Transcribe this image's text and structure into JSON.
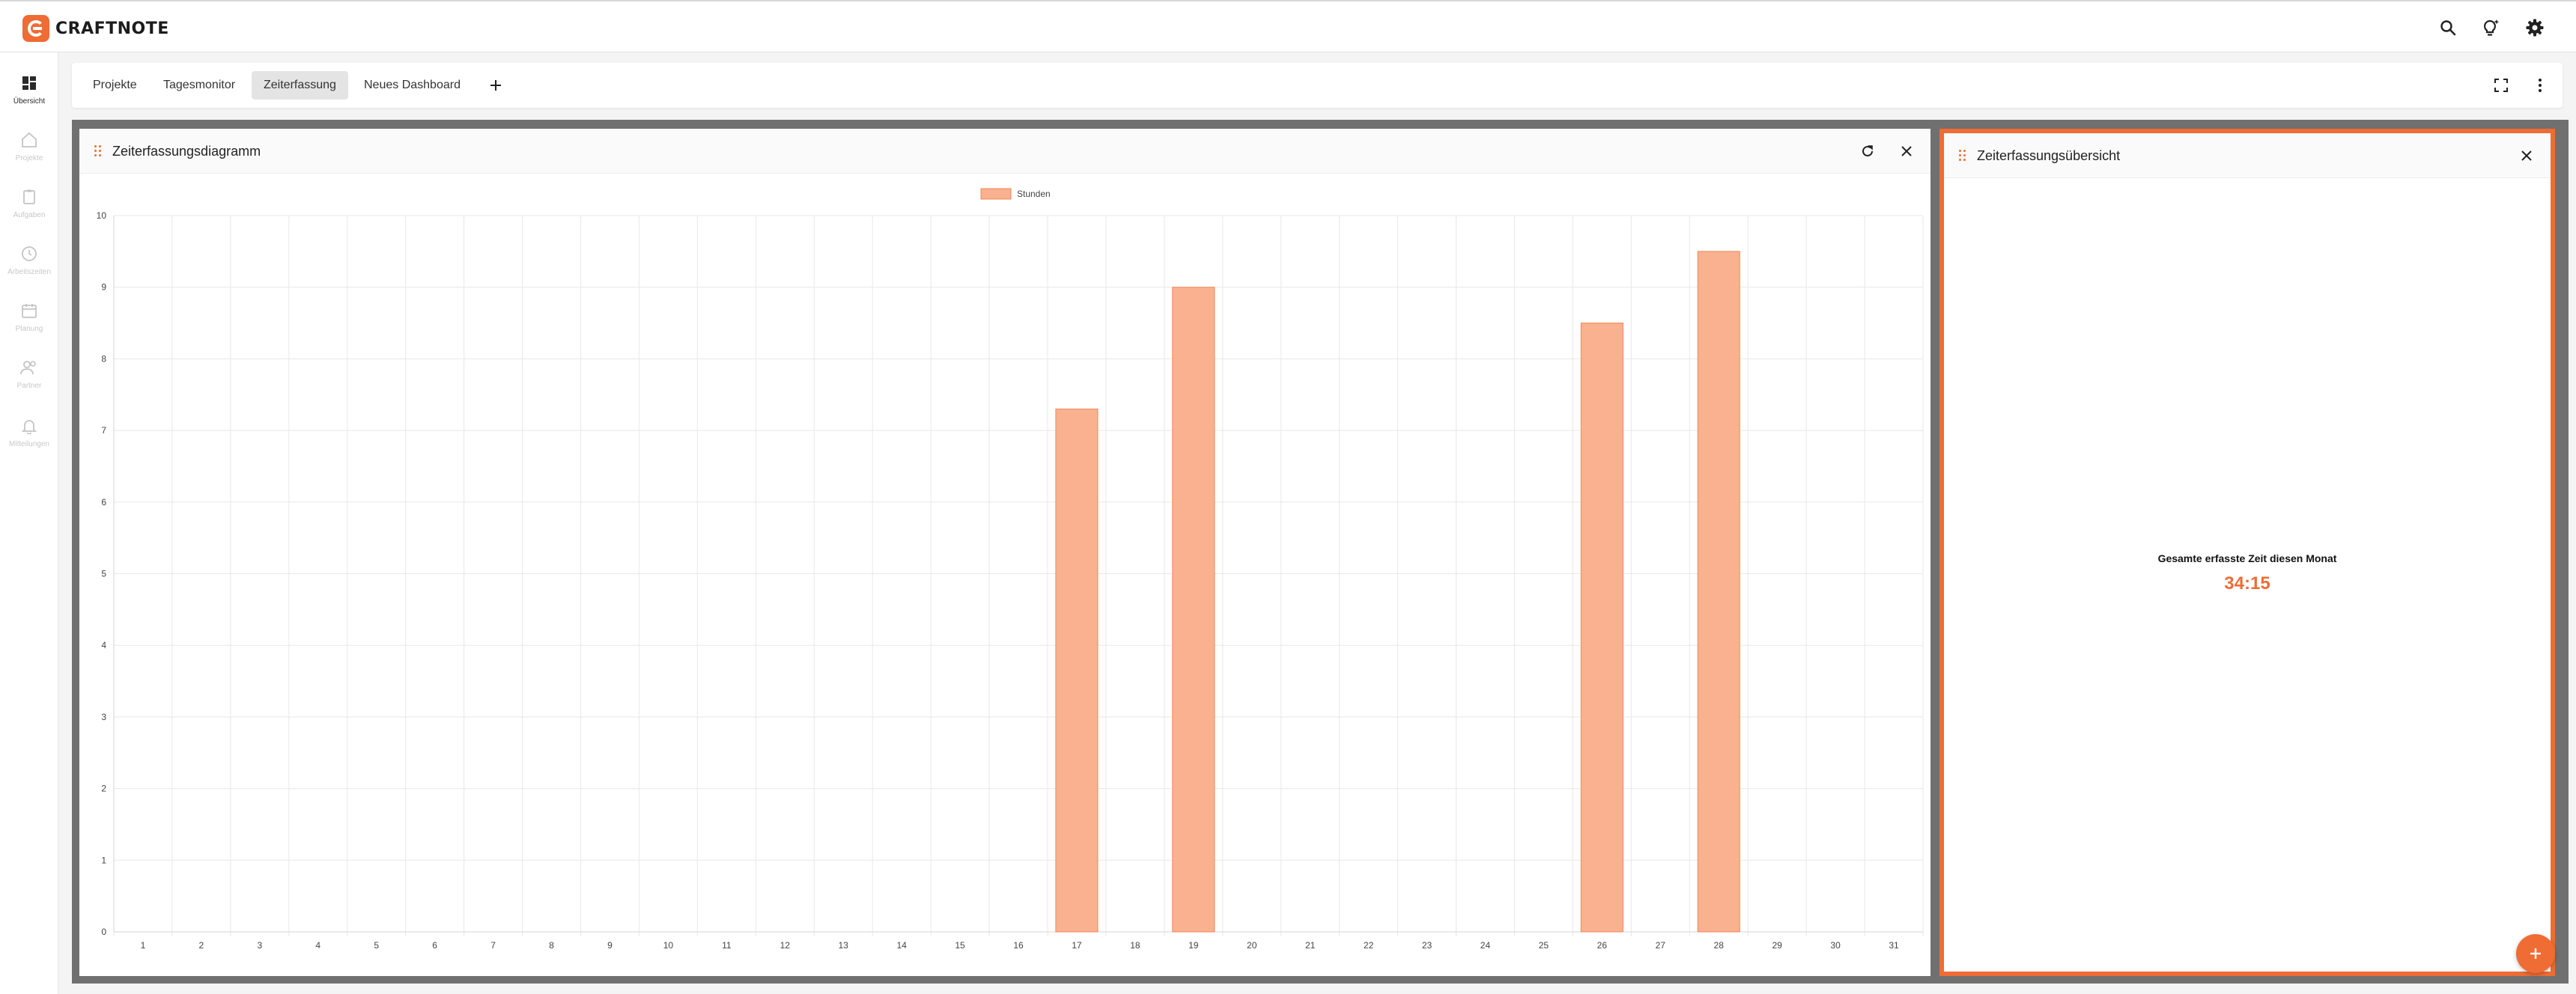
{
  "app": {
    "name": "CRAFTNOTE",
    "brand_color": "#ef6c35"
  },
  "topbar": {
    "icons": [
      "search-icon",
      "lightbulb-icon",
      "gear-icon"
    ]
  },
  "sidebar": {
    "items": [
      {
        "label": "Übersicht",
        "icon": "dashboard-icon",
        "active": true
      },
      {
        "label": "Projekte",
        "icon": "home-icon",
        "active": false
      },
      {
        "label": "Aufgaben",
        "icon": "clipboard-icon",
        "active": false
      },
      {
        "label": "Arbeitszeiten",
        "icon": "clock-icon",
        "active": false
      },
      {
        "label": "Planung",
        "icon": "calendar-icon",
        "active": false
      },
      {
        "label": "Partner",
        "icon": "people-icon",
        "active": false
      },
      {
        "label": "Mitteilungen",
        "icon": "bell-icon",
        "active": false
      }
    ]
  },
  "tabs": {
    "items": [
      {
        "label": "Projekte",
        "active": false
      },
      {
        "label": "Tagesmonitor",
        "active": false
      },
      {
        "label": "Zeiterfassung",
        "active": true
      },
      {
        "label": "Neues Dashboard",
        "active": false
      }
    ],
    "icons": [
      "fullscreen-icon",
      "more-vertical-icon"
    ]
  },
  "chart_widget": {
    "title": "Zeiterfassungsdiagramm"
  },
  "summary_widget": {
    "title": "Zeiterfassungsübersicht",
    "label": "Gesamte erfasste Zeit diesen Monat",
    "value": "34:15"
  },
  "chart_data": {
    "type": "bar",
    "categories": [
      "1",
      "2",
      "3",
      "4",
      "5",
      "6",
      "7",
      "8",
      "9",
      "10",
      "11",
      "12",
      "13",
      "14",
      "15",
      "16",
      "17",
      "18",
      "19",
      "20",
      "21",
      "22",
      "23",
      "24",
      "25",
      "26",
      "27",
      "28",
      "29",
      "30",
      "31"
    ],
    "series": [
      {
        "name": "Stunden",
        "values": [
          0,
          0,
          0,
          0,
          0,
          0,
          0,
          0,
          0,
          0,
          0,
          0,
          0,
          0,
          0,
          0,
          7.3,
          0,
          9,
          0,
          0,
          0,
          0,
          0,
          0,
          8.5,
          0,
          9.5,
          0,
          0,
          0
        ],
        "color": "#f9b18f",
        "border_color": "#ef8a5e"
      }
    ],
    "ylim": [
      0,
      10
    ],
    "yticks": [
      0,
      1,
      2,
      3,
      4,
      5,
      6,
      7,
      8,
      9,
      10
    ],
    "grid": true,
    "legend": "top-center"
  }
}
